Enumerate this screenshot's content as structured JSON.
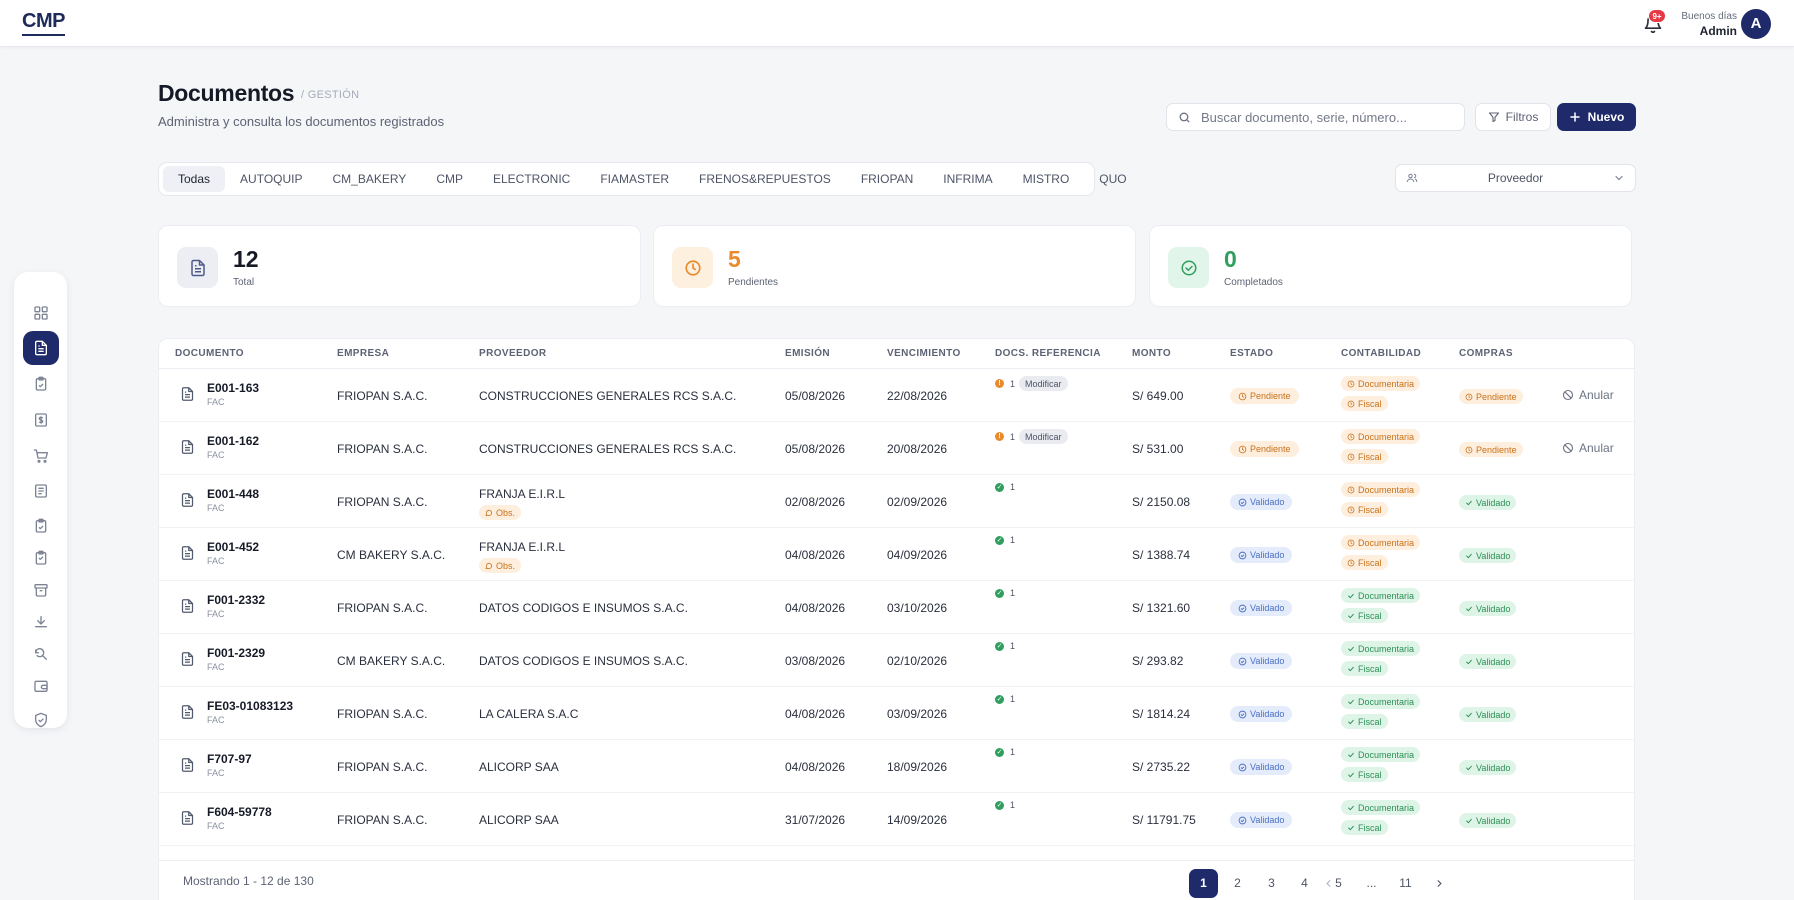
{
  "header": {
    "logo": "CMP",
    "notifications_badge": "9+",
    "greeting": "Buenos días",
    "user_name": "Admin",
    "avatar_letter": "A"
  },
  "sidebar": {
    "items": [
      {
        "icon": "grid-icon",
        "active": false
      },
      {
        "icon": "document-icon",
        "active": true
      },
      {
        "icon": "clipboard-check-icon",
        "active": false
      },
      {
        "icon": "dollar-icon",
        "active": false
      },
      {
        "icon": "cart-icon",
        "active": false
      },
      {
        "icon": "book-icon",
        "active": false
      },
      {
        "icon": "clipboard-icon",
        "active": false
      },
      {
        "icon": "clipboard-list-icon",
        "active": false
      },
      {
        "icon": "archive-icon",
        "active": false
      },
      {
        "icon": "download-icon",
        "active": false
      },
      {
        "icon": "search-refresh-icon",
        "active": false
      },
      {
        "icon": "wallet-icon",
        "active": false
      },
      {
        "icon": "shield-check-icon",
        "active": false
      }
    ]
  },
  "page": {
    "title": "Documentos",
    "breadcrumb": "/ GESTIÓN",
    "subtitle": "Administra y consulta los documentos registrados",
    "search_placeholder": "Buscar documento, serie, número...",
    "filter_label": "Filtros",
    "new_label": "Nuevo",
    "provider_select": "Proveedor"
  },
  "tabs": [
    "Todas",
    "AUTOQUIP",
    "CM_BAKERY",
    "CMP",
    "ELECTRONIC",
    "FIAMASTER",
    "FRENOS&REPUESTOS",
    "FRIOPAN",
    "INFRIMA",
    "MISTRO",
    "QUO"
  ],
  "active_tab": "Todas",
  "stats": [
    {
      "value": "12",
      "label": "Total",
      "color": "#161a26",
      "icon": "document-icon",
      "bg": "#eceef4",
      "fg": "#4e5a8a"
    },
    {
      "value": "5",
      "label": "Pendientes",
      "color": "#e98a2c",
      "icon": "clock-icon",
      "bg": "#fdf0df",
      "fg": "#e98a2c"
    },
    {
      "value": "0",
      "label": "Completados",
      "color": "#2f9e5e",
      "icon": "check-circle-icon",
      "bg": "#e2f5ea",
      "fg": "#2f9e5e"
    }
  ],
  "table": {
    "columns": [
      "DOCUMENTO",
      "EMPRESA",
      "PROVEEDOR",
      "EMISIÓN",
      "VENCIMIENTO",
      "DOCS. REFERENCIA",
      "MONTO",
      "ESTADO",
      "CONTABILIDAD",
      "COMPRAS"
    ],
    "rows": [
      {
        "doc": "E001-163",
        "type": "FAC",
        "empresa": "FRIOPAN S.A.C.",
        "proveedor": "CONSTRUCCIONES GENERALES RCS S.A.C.",
        "obs": "",
        "emision": "05/08/2026",
        "venc": "22/08/2026",
        "ref_status": "warn",
        "ref_count": "1",
        "ref_tag": "Modificar",
        "monto": "S/ 649.00",
        "estado": "Pendiente",
        "conta": [
          "Documentaria",
          "Fiscal"
        ],
        "conta_ok": false,
        "compras": "Pendiente",
        "action": "Anular"
      },
      {
        "doc": "E001-162",
        "type": "FAC",
        "empresa": "FRIOPAN S.A.C.",
        "proveedor": "CONSTRUCCIONES GENERALES RCS S.A.C.",
        "obs": "",
        "emision": "05/08/2026",
        "venc": "20/08/2026",
        "ref_status": "warn",
        "ref_count": "1",
        "ref_tag": "Modificar",
        "monto": "S/ 531.00",
        "estado": "Pendiente",
        "conta": [
          "Documentaria",
          "Fiscal"
        ],
        "conta_ok": false,
        "compras": "Pendiente",
        "action": "Anular"
      },
      {
        "doc": "E001-448",
        "type": "FAC",
        "empresa": "FRIOPAN S.A.C.",
        "proveedor": "FRANJA E.I.R.L",
        "obs": "Obs.",
        "emision": "02/08/2026",
        "venc": "02/09/2026",
        "ref_status": "ok",
        "ref_count": "1",
        "ref_tag": "",
        "monto": "S/ 2150.08",
        "estado": "Validado",
        "conta": [
          "Documentaria",
          "Fiscal"
        ],
        "conta_ok": false,
        "compras": "Validado",
        "action": ""
      },
      {
        "doc": "E001-452",
        "type": "FAC",
        "empresa": "CM BAKERY S.A.C.",
        "proveedor": "FRANJA E.I.R.L",
        "obs": "Obs.",
        "emision": "04/08/2026",
        "venc": "04/09/2026",
        "ref_status": "ok",
        "ref_count": "1",
        "ref_tag": "",
        "monto": "S/ 1388.74",
        "estado": "Validado",
        "conta": [
          "Documentaria",
          "Fiscal"
        ],
        "conta_ok": false,
        "compras": "Validado",
        "action": ""
      },
      {
        "doc": "F001-2332",
        "type": "FAC",
        "empresa": "FRIOPAN S.A.C.",
        "proveedor": "DATOS CODIGOS E INSUMOS S.A.C.",
        "obs": "",
        "emision": "04/08/2026",
        "venc": "03/10/2026",
        "ref_status": "ok",
        "ref_count": "1",
        "ref_tag": "",
        "monto": "S/ 1321.60",
        "estado": "Validado",
        "conta": [
          "Documentaria",
          "Fiscal"
        ],
        "conta_ok": true,
        "compras": "Validado",
        "action": ""
      },
      {
        "doc": "F001-2329",
        "type": "FAC",
        "empresa": "CM BAKERY S.A.C.",
        "proveedor": "DATOS CODIGOS E INSUMOS S.A.C.",
        "obs": "",
        "emision": "03/08/2026",
        "venc": "02/10/2026",
        "ref_status": "ok",
        "ref_count": "1",
        "ref_tag": "",
        "monto": "S/ 293.82",
        "estado": "Validado",
        "conta": [
          "Documentaria",
          "Fiscal"
        ],
        "conta_ok": true,
        "compras": "Validado",
        "action": ""
      },
      {
        "doc": "FE03-01083123",
        "type": "FAC",
        "empresa": "FRIOPAN S.A.C.",
        "proveedor": "LA CALERA S.A.C",
        "obs": "",
        "emision": "04/08/2026",
        "venc": "03/09/2026",
        "ref_status": "ok",
        "ref_count": "1",
        "ref_tag": "",
        "monto": "S/ 1814.24",
        "estado": "Validado",
        "conta": [
          "Documentaria",
          "Fiscal"
        ],
        "conta_ok": true,
        "compras": "Validado",
        "action": ""
      },
      {
        "doc": "F707-97",
        "type": "FAC",
        "empresa": "FRIOPAN S.A.C.",
        "proveedor": "ALICORP SAA",
        "obs": "",
        "emision": "04/08/2026",
        "venc": "18/09/2026",
        "ref_status": "ok",
        "ref_count": "1",
        "ref_tag": "",
        "monto": "S/ 2735.22",
        "estado": "Validado",
        "conta": [
          "Documentaria",
          "Fiscal"
        ],
        "conta_ok": true,
        "compras": "Validado",
        "action": ""
      },
      {
        "doc": "F604-59778",
        "type": "FAC",
        "empresa": "FRIOPAN S.A.C.",
        "proveedor": "ALICORP SAA",
        "obs": "",
        "emision": "31/07/2026",
        "venc": "14/09/2026",
        "ref_status": "ok",
        "ref_count": "1",
        "ref_tag": "",
        "monto": "S/ 11791.75",
        "estado": "Validado",
        "conta": [
          "Documentaria",
          "Fiscal"
        ],
        "conta_ok": true,
        "compras": "Validado",
        "action": ""
      }
    ]
  },
  "pagination": {
    "showing": "Mostrando 1 - 12 de 130",
    "pages": [
      "1",
      "2",
      "3",
      "4",
      "5",
      "...",
      "11"
    ],
    "current": "1"
  }
}
